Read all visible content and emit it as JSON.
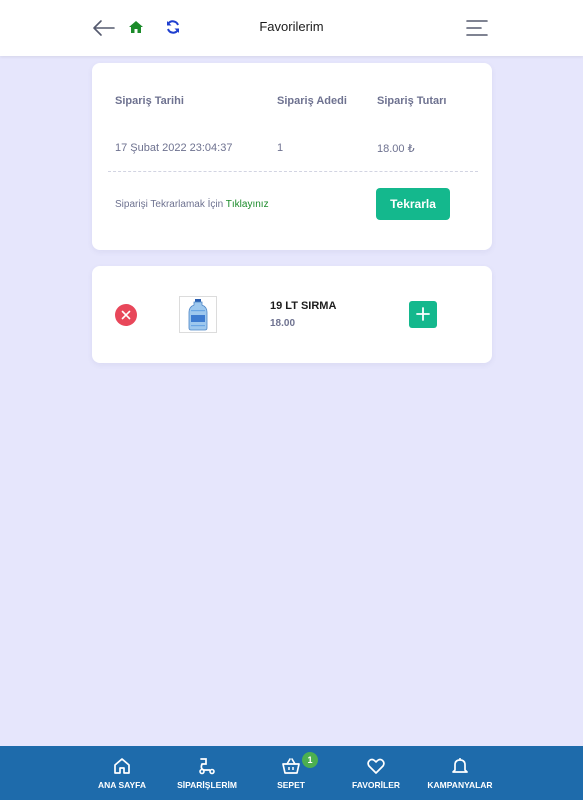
{
  "header": {
    "title": "Favorilerim",
    "back_icon": "arrow-left-icon",
    "home_icon": "home-icon",
    "refresh_icon": "refresh-icon",
    "menu_icon": "hamburger-menu-icon"
  },
  "order": {
    "columns": [
      "Sipariş Tarihi",
      "Sipariş Adedi",
      "Sipariş Tutarı"
    ],
    "date": "17 Şubat 2022 23:04:37",
    "quantity": "1",
    "amount": "18.00 ₺",
    "repeat_text": "Siparişi Tekrarlamak İçin",
    "repeat_link": "Tıklayınız",
    "repeat_button": "Tekrarla"
  },
  "favorite": {
    "name": "19 LT SIRMA",
    "price": "18.00",
    "remove_icon": "close-icon",
    "add_icon": "plus-icon",
    "image_icon": "water-bottle-icon"
  },
  "bottom_nav": {
    "items": [
      {
        "label": "ANA SAYFA",
        "icon": "home-icon"
      },
      {
        "label": "SİPARİŞLERİM",
        "icon": "scooter-icon"
      },
      {
        "label": "SEPET",
        "icon": "basket-icon"
      },
      {
        "label": "FAVORİLER",
        "icon": "heart-icon"
      },
      {
        "label": "KAMPANYALAR",
        "icon": "bell-icon"
      }
    ],
    "cart_count": "1"
  },
  "colors": {
    "background": "#e6e6fc",
    "primary_button": "#14b88d",
    "remove": "#e8475a",
    "nav_bar": "#1e6bab",
    "link": "#1b8b2a",
    "badge": "#4caf50"
  }
}
